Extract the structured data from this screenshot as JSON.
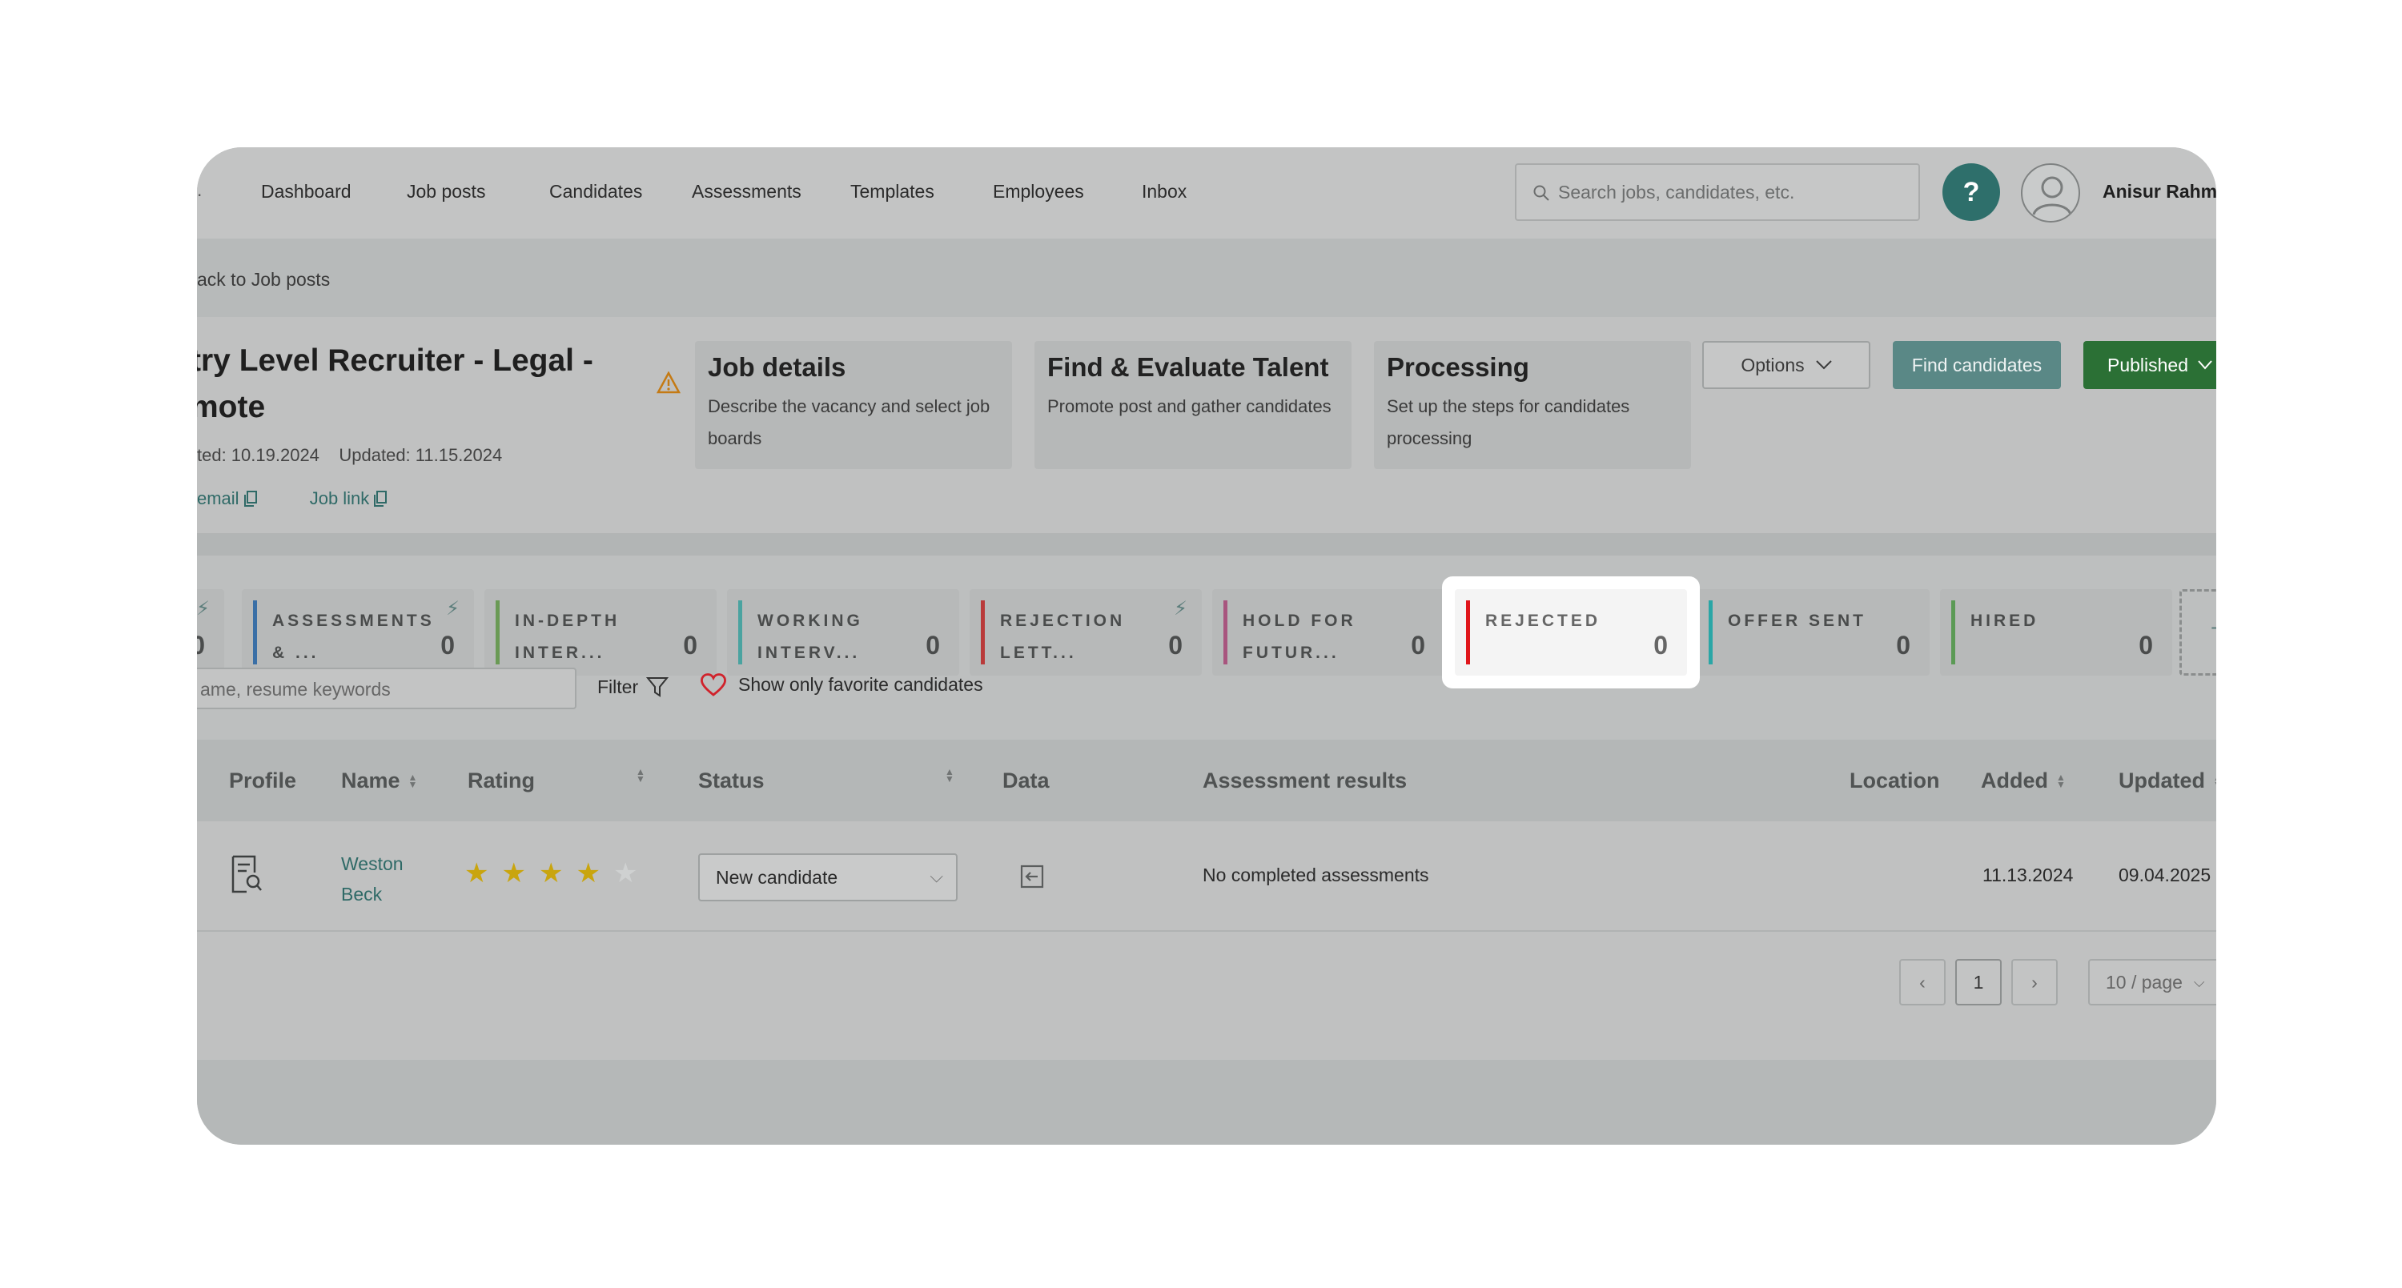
{
  "nav": {
    "items": [
      "Dashboard",
      "Job posts",
      "Candidates",
      "Assessments",
      "Templates",
      "Employees",
      "Inbox"
    ],
    "search_placeholder": "Search jobs, candidates, etc.",
    "help_label": "?",
    "user_name": "Anisur Rahm"
  },
  "breadcrumb": {
    "back_label": "ack to Job posts"
  },
  "job": {
    "title": "try Level Recruiter - Legal - mote",
    "created": "ted: 10.19.2024",
    "updated": "Updated: 11.15.2024",
    "email_link": "email",
    "job_link": "Job link"
  },
  "steps": [
    {
      "title": "Job details",
      "desc": "Describe the vacancy and select job boards"
    },
    {
      "title": "Find & Evaluate Talent",
      "desc": "Promote post and gather candidates"
    },
    {
      "title": "Processing",
      "desc": "Set up the steps for candidates processing"
    }
  ],
  "actions": {
    "options_label": "Options",
    "find_label": "Find candidates",
    "published_label": "Published"
  },
  "pipeline": {
    "first_count": "0",
    "stages": [
      {
        "label": "ASSESSMENTS\n& ...",
        "count": "0",
        "color": "#3a6fa6",
        "bolt": true
      },
      {
        "label": "IN-DEPTH\nINTER...",
        "count": "0",
        "color": "#6a9a55",
        "bolt": false
      },
      {
        "label": "WORKING\nINTERV...",
        "count": "0",
        "color": "#4aa3a0",
        "bolt": false
      },
      {
        "label": "REJECTION\nLETT...",
        "count": "0",
        "color": "#b93a3a",
        "bolt": true
      },
      {
        "label": "HOLD FOR\nFUTUR...",
        "count": "0",
        "color": "#a8557e",
        "bolt": false
      },
      {
        "label": "REJECTED",
        "count": "0",
        "color": "#e0161b",
        "bolt": false
      },
      {
        "label": "OFFER SENT",
        "count": "0",
        "color": "#2aa6a6",
        "bolt": false
      },
      {
        "label": "HIRED",
        "count": "0",
        "color": "#5b9a55",
        "bolt": false
      }
    ],
    "add_label": "+"
  },
  "filters": {
    "keywords_placeholder": "ame, resume keywords",
    "filter_label": "Filter",
    "favorite_label": "Show only favorite candidates"
  },
  "table": {
    "headers": {
      "profile": "Profile",
      "name": "Name",
      "rating": "Rating",
      "status": "Status",
      "data": "Data",
      "assessment": "Assessment results",
      "location": "Location",
      "added": "Added",
      "updated": "Updated"
    },
    "rows": [
      {
        "name": "Weston\nBeck",
        "rating": 4,
        "status": "New candidate",
        "assessment": "No completed assessments",
        "location": "",
        "added": "11.13.2024",
        "updated": "09.04.2025"
      }
    ]
  },
  "pagination": {
    "current_page": "1",
    "page_size": "10 / page"
  },
  "colors": {
    "accent": "#2e6f6b",
    "published": "#2b7035",
    "star": "#c9a50e"
  }
}
